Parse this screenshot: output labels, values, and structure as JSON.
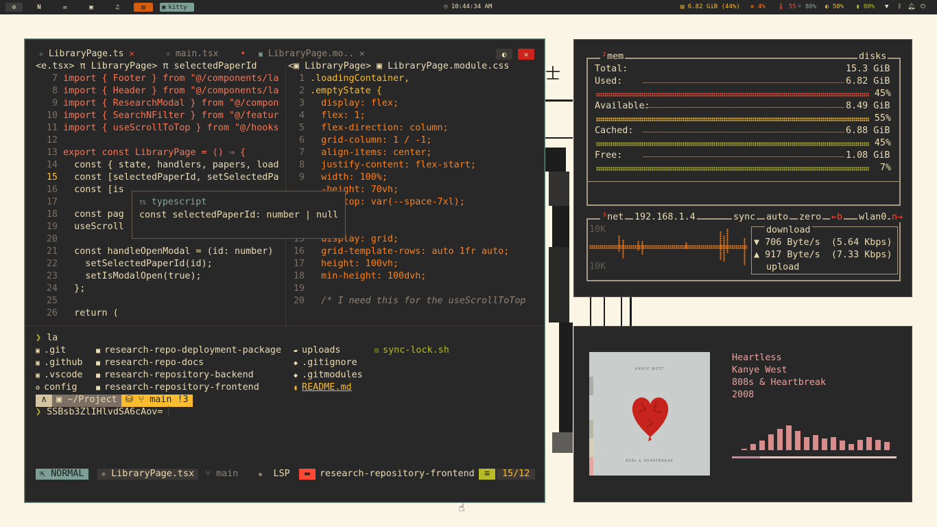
{
  "topbar": {
    "workspaces": [
      {
        "icon": "settings-icon",
        "label": "⚙"
      },
      {
        "icon": "notion-icon",
        "label": "N"
      },
      {
        "icon": "mail-icon",
        "label": "✉"
      },
      {
        "icon": "archive-icon",
        "label": "▣"
      },
      {
        "icon": "music-icon",
        "label": "♫"
      },
      {
        "icon": "terminal-icon",
        "label": "▤"
      }
    ],
    "kitty_label": "kitty",
    "clock": "10:44:34 AM",
    "memory": "6.82 GiB (44%)",
    "cpu": "4%",
    "temp": "55",
    "brightness": "80%",
    "volume": "50%",
    "battery": "80%"
  },
  "editor": {
    "tabs": [
      {
        "label": "LibraryPage.ts",
        "close": "✕",
        "active": true
      },
      {
        "label": "main.tsx",
        "close": "•",
        "active": false
      },
      {
        "label": "LibraryPage.mo..",
        "close": "✕",
        "active": false
      }
    ],
    "left_breadcrumb": "<e.tsx> π LibraryPage> π selectedPaperId",
    "right_breadcrumb": "<▣ LibraryPage> ▣ LibraryPage.module.css",
    "left_lines": [
      {
        "n": "7",
        "t": "import { Footer } from \"@/components/la"
      },
      {
        "n": "8",
        "t": "import { Header } from \"@/components/la"
      },
      {
        "n": "9",
        "t": "import { ResearchModal } from \"@/compon"
      },
      {
        "n": "10",
        "t": "import { SearchNFilter } from \"@/featur"
      },
      {
        "n": "11",
        "t": "import { useScrollToTop } from \"@/hooks"
      },
      {
        "n": "12",
        "t": ""
      },
      {
        "n": "13",
        "t": "export const LibraryPage = () ⇒ {"
      },
      {
        "n": "14",
        "t": "  const { state, handlers, papers, load"
      },
      {
        "n": "15",
        "t": "  const [selectedPaperId, setSelectedPa"
      },
      {
        "n": "16",
        "t": "  const [is"
      },
      {
        "n": "17",
        "t": ""
      },
      {
        "n": "18",
        "t": "  const pag"
      },
      {
        "n": "19",
        "t": "  useScroll"
      },
      {
        "n": "20",
        "t": ""
      },
      {
        "n": "21",
        "t": "  const handleOpenModal = (id: number)"
      },
      {
        "n": "22",
        "t": "    setSelectedPaperId(id);"
      },
      {
        "n": "23",
        "t": "    setIsModalOpen(true);"
      },
      {
        "n": "24",
        "t": "  };"
      },
      {
        "n": "25",
        "t": ""
      },
      {
        "n": "26",
        "t": "  return ("
      }
    ],
    "right_lines": [
      {
        "n": "1",
        "t": ".loadingContainer,"
      },
      {
        "n": "2",
        "t": ".emptyState {"
      },
      {
        "n": "3",
        "t": "  display: flex;"
      },
      {
        "n": "4",
        "t": "  flex: 1;"
      },
      {
        "n": "5",
        "t": "  flex-direction: column;"
      },
      {
        "n": "6",
        "t": "  grid-column: 1 / -1;"
      },
      {
        "n": "7",
        "t": "  align-items: center;"
      },
      {
        "n": "8",
        "t": "  justify-content: flex-start;"
      },
      {
        "n": "9",
        "t": "  width: 100%;"
      },
      {
        "n": "",
        "t": "  -height: 70vh;"
      },
      {
        "n": "",
        "t": "  gin-top: var(--space-7xl);"
      },
      {
        "n": "",
        "t": ""
      },
      {
        "n": "",
        "t": "  {"
      },
      {
        "n": "15",
        "t": "  display: grid;"
      },
      {
        "n": "16",
        "t": "  grid-template-rows: auto 1fr auto;"
      },
      {
        "n": "17",
        "t": "  height: 100vh;"
      },
      {
        "n": "18",
        "t": "  min-height: 100dvh;"
      },
      {
        "n": "19",
        "t": ""
      },
      {
        "n": "20",
        "t": "  /* I need this for the useScrollToTop"
      }
    ],
    "hover_lang": "typescript",
    "hover_sig": "const selectedPaperId: number | null"
  },
  "terminal": {
    "prompt_cmd": "la",
    "cols": [
      [
        ".git",
        ".github",
        ".vscode",
        "config"
      ],
      [
        "research-repo-deployment-package",
        "research-repo-docs",
        "research-repository-backend",
        "research-repository-frontend"
      ],
      [
        "uploads",
        ".gitignore",
        ".gitmodules",
        "README.md"
      ],
      [
        "sync-lock.sh",
        "",
        "",
        ""
      ]
    ],
    "ps_path": "~/Project",
    "ps_branch": "main !3",
    "input": "SSBsb3ZlIHlvdSA6cAov="
  },
  "statusline": {
    "mode": "NORMAL",
    "file": "LibraryPage.tsx",
    "branch": "main",
    "lsp": "LSP",
    "project": "research-repository-frontend",
    "pos": "15/12"
  },
  "btop": {
    "mem_title": "mem",
    "mem_index": "²",
    "disks": "disks",
    "rows": [
      {
        "label": "Total:",
        "value": "15.3 GiB",
        "pct": ""
      },
      {
        "label": "Used:",
        "value": "6.82 GiB",
        "pct": "45%"
      },
      {
        "label": "Available:",
        "value": "8.49 GiB",
        "pct": "55%"
      },
      {
        "label": "Cached:",
        "value": "6.88 GiB",
        "pct": "45%"
      },
      {
        "label": "Free:",
        "value": "1.08 GiB",
        "pct": "7%"
      }
    ],
    "net_index": "³",
    "net_title": "net",
    "ip": "192.168.1.4",
    "sync": "sync",
    "auto": "auto",
    "zero": "zero",
    "b_key": "←b",
    "iface": "wlan0",
    "n_key": "n→",
    "scale_top": "10K",
    "scale_bottom": "10K",
    "download_label": "download",
    "download": "▼ 706 Byte/s  (5.64 Kbps)",
    "upload": "▲ 917 Byte/s  (7.33 Kbps)",
    "upload_label": "upload"
  },
  "music": {
    "title": "Heartless",
    "artist": "Kanye West",
    "album": "808s & Heartbreak",
    "year": "2008",
    "album_top_text": "KANYE WEST",
    "album_bottom_text": "808s & HEARTBREAK",
    "progress": 0.17,
    "visualizer": [
      2,
      9,
      14,
      22,
      30,
      35,
      27,
      18,
      21,
      17,
      18,
      14,
      9,
      15,
      18,
      15,
      12
    ]
  }
}
